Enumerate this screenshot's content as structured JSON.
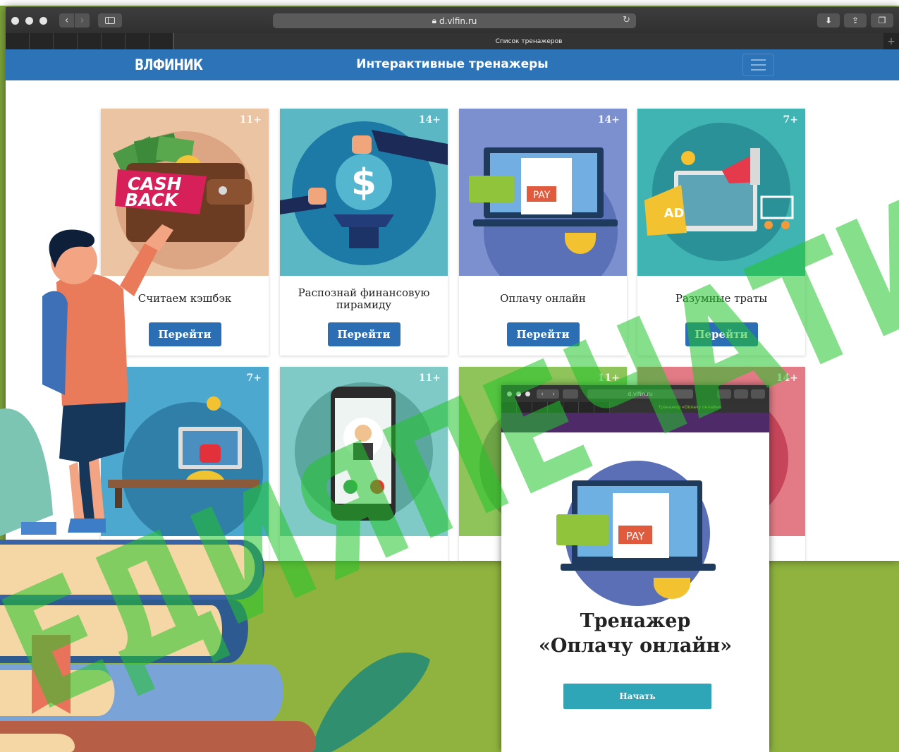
{
  "browser": {
    "url": "d.vlfin.ru",
    "tab_title": "Список тренажеров"
  },
  "site": {
    "logo": "ВЛФИНИК",
    "title": "Интерактивные тренажеры"
  },
  "cards": [
    {
      "title": "Считаем кэшбэк",
      "age": "11+",
      "button": "Перейти",
      "image_text": [
        "CASH",
        "BACK"
      ],
      "color": "#e8c3a3"
    },
    {
      "title": "Распознай финансовую пирамиду",
      "age": "14+",
      "button": "Перейти",
      "color": "#4fb0c2"
    },
    {
      "title": "Оплачу онлайн",
      "age": "14+",
      "button": "Перейти",
      "image_text": [
        "PAY"
      ],
      "color": "#7b8fcf"
    },
    {
      "title": "Разумные траты",
      "age": "7+",
      "button": "Перейти",
      "image_text": [
        "AD"
      ],
      "color": "#3bb1b1"
    },
    {
      "age": "7+",
      "color": "#4ba8cf"
    },
    {
      "age": "11+",
      "color": "#75c5c3"
    },
    {
      "age": "11+",
      "color": "#8ec45a"
    },
    {
      "age": "14+",
      "color": "#e27b85"
    }
  ],
  "popup": {
    "url": "d.vlfin.ru",
    "tab_title": "Тренажер «Оплачу онлайн»",
    "heading_line1": "Тренажер",
    "heading_line2": "«Оплачу онлайн»",
    "image_text": "PAY",
    "start_button": "Начать"
  },
  "watermark": "ЕДИЯПЕЧАТИ",
  "colors": {
    "header_blue": "#2d73b8",
    "button_blue": "#2c6eb4",
    "start_teal": "#2fa5b8",
    "background_green": "#8fb33e",
    "watermark_green": "#22c42a",
    "watermark_red": "#ff1a1a"
  }
}
